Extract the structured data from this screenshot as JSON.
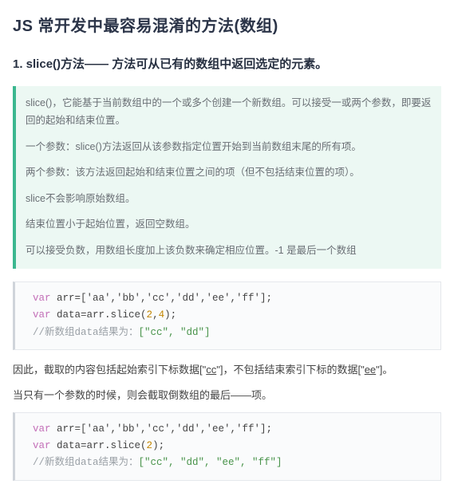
{
  "title": "JS 常开发中最容易混淆的方法(数组)",
  "section1": {
    "heading": "1. slice()方法—— 方法可从已有的数组中返回选定的元素。",
    "callout": {
      "p1": "slice()，它能基于当前数组中的一个或多个创建一个新数组。可以接受一或两个参数，即要返回的起始和结束位置。",
      "p2": "一个参数：slice()方法返回从该参数指定位置开始到当前数组末尾的所有项。",
      "p3": "两个参数：该方法返回起始和结束位置之间的项（但不包括结束位置的项）。",
      "p4": "slice不会影响原始数组。",
      "p5": "结束位置小于起始位置，返回空数组。",
      "p6": "可以接受负数，用数组长度加上该负数来确定相应位置。-1 是最后一个数组"
    },
    "code1": {
      "kw_var": "var",
      "l1_rest": " arr=['aa','bb','cc','dd','ee','ff'];",
      "l2_rest_a": " data=arr.slice(",
      "l2_n1": "2",
      "l2_comma": ",",
      "l2_n2": "4",
      "l2_rest_b": ");",
      "l3_prefix": "//新数组data结果为：",
      "l3_result": "[\"cc\", \"dd\"]"
    },
    "para1_a": "因此，截取的内容包括起始索引下标数据[\"",
    "para1_cc": "cc",
    "para1_b": "\"]，不包括结束索引下标的数据[\"",
    "para1_ee": "ee",
    "para1_c": "\"]。",
    "para2": "当只有一个参数的时候，则会截取倒数组的最后——项。",
    "code2": {
      "kw_var": "var",
      "l1_rest": " arr=['aa','bb','cc','dd','ee','ff'];",
      "l2_rest_a": " data=arr.slice(",
      "l2_n1": "2",
      "l2_rest_b": ");",
      "l3_prefix": "//新数组data结果为：",
      "l3_result": "[\"cc\", \"dd\", \"ee\", \"ff\"]"
    }
  }
}
